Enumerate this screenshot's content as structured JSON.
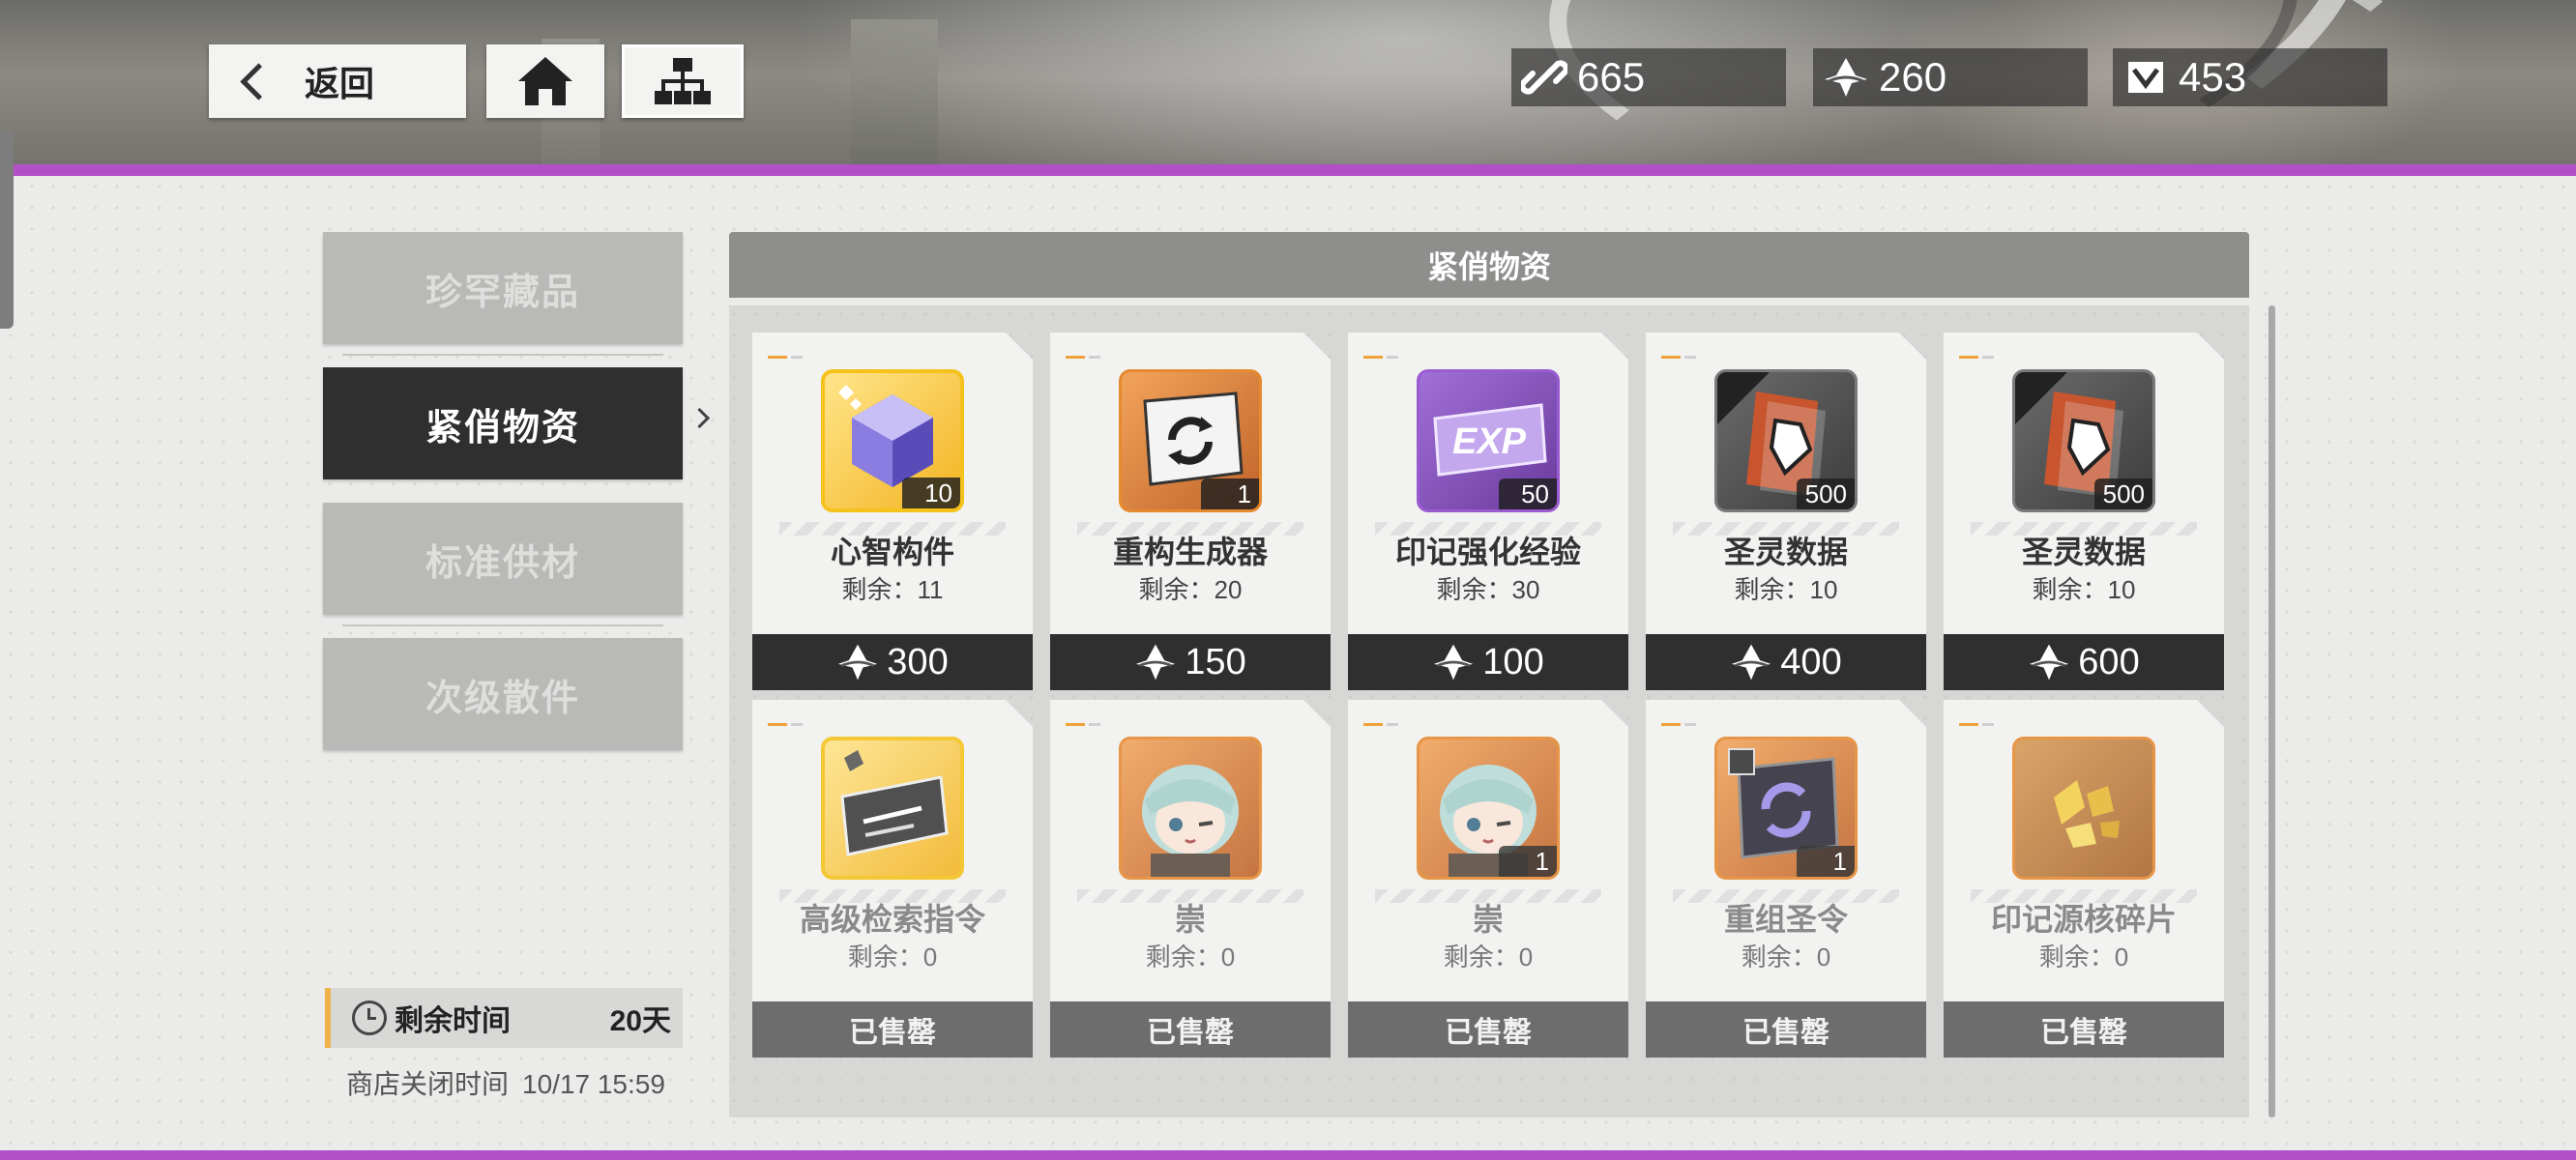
{
  "topbar": {
    "back_label": "返回",
    "currencies": [
      {
        "icon": "link-icon",
        "value": "665"
      },
      {
        "icon": "crystal-icon",
        "value": "260"
      },
      {
        "icon": "ticket-icon",
        "value": "453"
      }
    ]
  },
  "sidebar": {
    "tabs": [
      {
        "label": "珍罕藏品",
        "active": false
      },
      {
        "label": "紧俏物资",
        "active": true
      },
      {
        "label": "标准供材",
        "active": false
      },
      {
        "label": "次级散件",
        "active": false
      }
    ],
    "timer_label": "剩余时间",
    "timer_value": "20天",
    "close_label": "商店关闭时间",
    "close_value": "10/17 15:59"
  },
  "shop": {
    "title": "紧俏物资",
    "sold_label": "已售罄",
    "items": [
      {
        "name": "心智构件",
        "remain": "剩余：11",
        "qty": "10",
        "price": "300",
        "sold": false,
        "icon": "mind-cube-icon"
      },
      {
        "name": "重构生成器",
        "remain": "剩余：20",
        "qty": "1",
        "price": "150",
        "sold": false,
        "icon": "rebuild-generator-icon"
      },
      {
        "name": "印记强化经验",
        "remain": "剩余：30",
        "qty": "50",
        "price": "100",
        "sold": false,
        "icon": "exp-chip-icon"
      },
      {
        "name": "圣灵数据",
        "remain": "剩余：10",
        "qty": "500",
        "price": "400",
        "sold": false,
        "icon": "spirit-data-icon"
      },
      {
        "name": "圣灵数据",
        "remain": "剩余：10",
        "qty": "500",
        "price": "600",
        "sold": false,
        "icon": "spirit-data-icon"
      },
      {
        "name": "高级检索指令",
        "remain": "剩余：0",
        "qty": "",
        "price": "",
        "sold": true,
        "icon": "retrieval-instruction-icon"
      },
      {
        "name": "崇",
        "remain": "剩余：0",
        "qty": "",
        "price": "",
        "sold": true,
        "icon": "chibi-character-icon"
      },
      {
        "name": "崇",
        "remain": "剩余：0",
        "qty": "1",
        "price": "",
        "sold": true,
        "icon": "chibi-character-icon"
      },
      {
        "name": "重组圣令",
        "remain": "剩余：0",
        "qty": "1",
        "price": "",
        "sold": true,
        "icon": "recombine-order-icon"
      },
      {
        "name": "印记源核碎片",
        "remain": "剩余：0",
        "qty": "",
        "price": "",
        "sold": true,
        "icon": "core-fragment-icon"
      }
    ]
  },
  "colors": {
    "accent_purple": "#b24fc9",
    "timer_accent": "#f0b24a",
    "tab_active": "#2f2f2f",
    "tab_inactive": "#b9b9b8",
    "rarity_gold": "#f5c21c",
    "rarity_orange": "#e58a2f",
    "rarity_purple": "#9a5bd0"
  }
}
